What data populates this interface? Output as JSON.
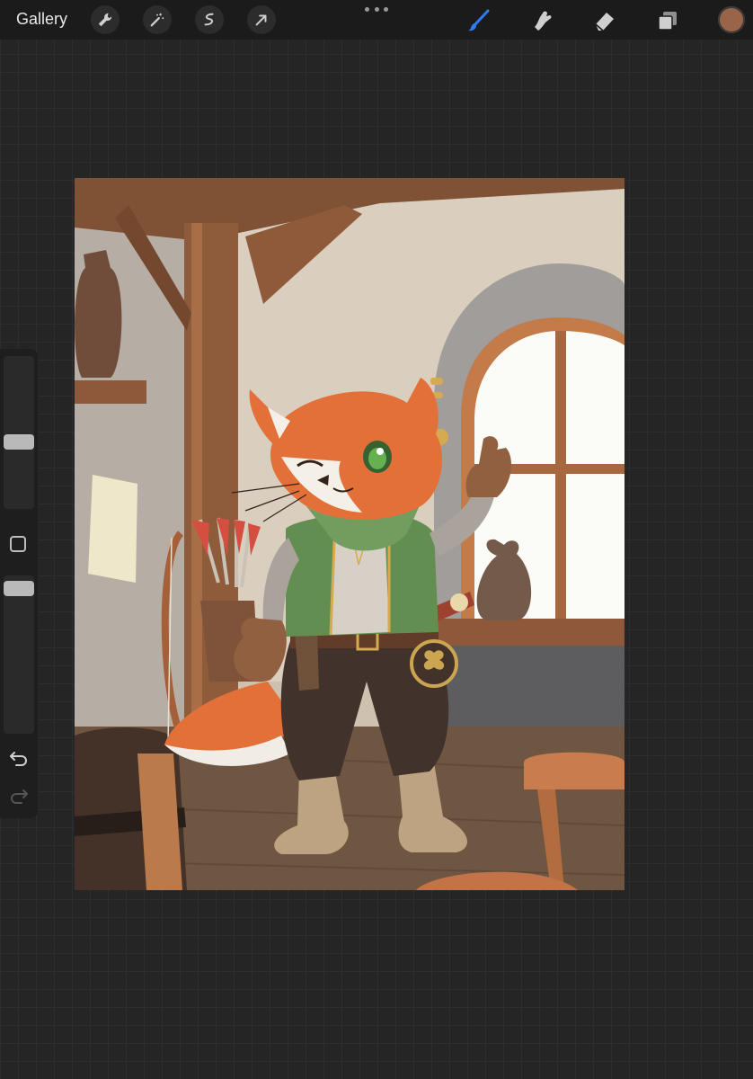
{
  "toolbar": {
    "gallery_label": "Gallery",
    "left_tools": [
      "wrench-icon",
      "magic-wand-icon",
      "selection-icon",
      "transform-arrow-icon"
    ],
    "right_tools": [
      "brush-icon",
      "smudge-icon",
      "eraser-icon",
      "layers-icon"
    ],
    "active_tool": "brush-icon",
    "accent_color": "#2f7bf5",
    "current_color": "#9a6448"
  },
  "sidebar": {
    "brush_size_level": 0.52,
    "opacity_level": 1.0,
    "controls": [
      "brush-size-slider",
      "modify-button",
      "opacity-slider",
      "undo-icon",
      "redo-icon"
    ]
  },
  "canvas": {
    "artwork": "fox-adventurer-illustration"
  }
}
